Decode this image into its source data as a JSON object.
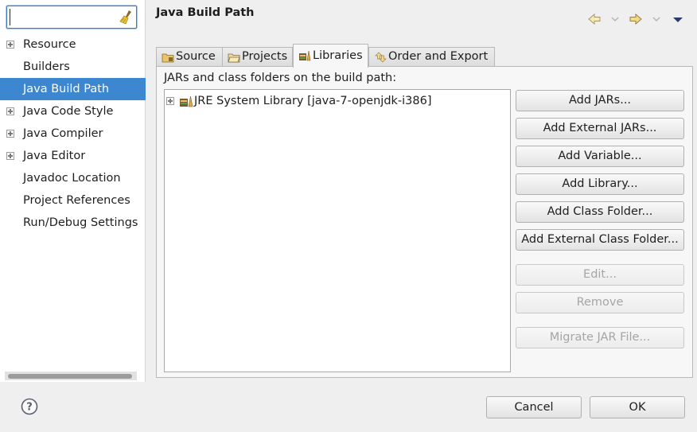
{
  "filter": {
    "value": "",
    "placeholder": ""
  },
  "sidebar": {
    "items": [
      {
        "label": "Resource",
        "expandable": true
      },
      {
        "label": "Builders",
        "expandable": false
      },
      {
        "label": "Java Build Path",
        "expandable": false,
        "selected": true
      },
      {
        "label": "Java Code Style",
        "expandable": true
      },
      {
        "label": "Java Compiler",
        "expandable": true
      },
      {
        "label": "Java Editor",
        "expandable": true
      },
      {
        "label": "Javadoc Location",
        "expandable": false
      },
      {
        "label": "Project References",
        "expandable": false
      },
      {
        "label": "Run/Debug Settings",
        "expandable": false
      }
    ]
  },
  "header": {
    "title": "Java Build Path",
    "icons": [
      "back-arrow-icon",
      "back-dropdown-icon",
      "forward-arrow-icon",
      "forward-dropdown-icon",
      "view-menu-icon"
    ]
  },
  "tabs": [
    {
      "label": "Source",
      "icon": "source-folder-icon"
    },
    {
      "label": "Projects",
      "icon": "projects-folder-icon"
    },
    {
      "label": "Libraries",
      "icon": "libraries-icon",
      "active": true
    },
    {
      "label": "Order and Export",
      "icon": "order-export-icon"
    }
  ],
  "libraries": {
    "hint": "JARs and class folders on the build path:",
    "entries": [
      {
        "label": "JRE System Library [java-7-openjdk-i386]",
        "icon": "library-icon"
      }
    ],
    "buttons": {
      "add_jars": "Add JARs...",
      "add_external_jars": "Add External JARs...",
      "add_variable": "Add Variable...",
      "add_library": "Add Library...",
      "add_class_folder": "Add Class Folder...",
      "add_external_class_folder": "Add External Class Folder...",
      "edit": "Edit...",
      "remove": "Remove",
      "migrate_jar": "Migrate JAR File..."
    }
  },
  "footer": {
    "cancel": "Cancel",
    "ok": "OK",
    "help_icon": "help-icon"
  },
  "colors": {
    "selection": "#3d86d0",
    "focus": "#3c7fc0",
    "background": "#efefef"
  }
}
